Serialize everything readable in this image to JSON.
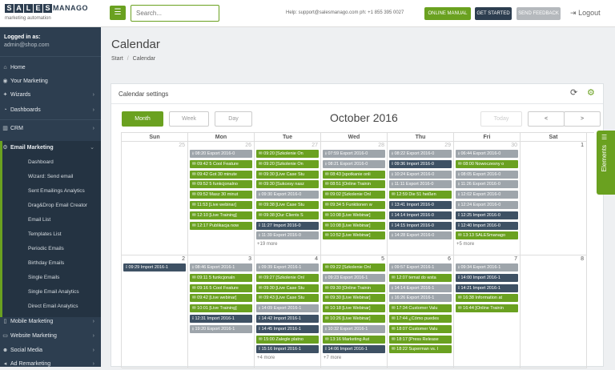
{
  "brand": {
    "logo_letters": [
      "S",
      "A",
      "L",
      "E",
      "S"
    ],
    "logo_word": "MANAGO",
    "tagline": "marketing automation",
    "accent": "#6aa120",
    "dark": "#2d3e50"
  },
  "top": {
    "search_placeholder": "Search...",
    "help": "Help:  support@salesmanago.com ph: +1 855 395 0027",
    "online_manual": "ONLINE MANUAL",
    "get_started": "GET STARTED",
    "send_feedback": "SEND FEEDBACK",
    "logout": "Logout"
  },
  "sidebar": {
    "logged_as": "Logged in as:",
    "email": "admin@shop.com",
    "items": [
      {
        "label": "Home",
        "icon": "home-icon"
      },
      {
        "label": "Your Marketing",
        "icon": "eye-icon"
      },
      {
        "label": "Wizards",
        "icon": "wand-icon"
      },
      {
        "label": "Dashboards",
        "icon": "dashboard-icon"
      },
      {
        "label": "CRM",
        "icon": "chart-icon"
      },
      {
        "label": "Email Marketing",
        "icon": "gear-icon"
      }
    ],
    "email_sub": [
      "Dashboard",
      "Wizard: Send email",
      "Sent Emailings Analytics",
      "Drag&Drop Email Creator",
      "Email List",
      "Templates List",
      "Periodic Emails",
      "Birthday Emails",
      "Single Emails",
      "Single Email Analytics",
      "Direct Email Analytics"
    ],
    "bottom": [
      {
        "label": "Mobile Marketing",
        "icon": "mobile-icon"
      },
      {
        "label": "Website Marketing",
        "icon": "monitor-icon"
      },
      {
        "label": "Social Media",
        "icon": "users-icon"
      },
      {
        "label": "Ad Remarketing",
        "icon": "megaphone-icon"
      }
    ]
  },
  "page": {
    "title": "Calendar",
    "crumb_start": "Start",
    "crumb_sep": "/",
    "crumb_current": "Calendar"
  },
  "calendar": {
    "settings_title": "Calendar settings",
    "views": {
      "month": "Month",
      "week": "Week",
      "day": "Day"
    },
    "title": "October 2016",
    "today": "Today",
    "prev": "<",
    "next": ">",
    "weekdays": [
      "Sun",
      "Mon",
      "Tue",
      "Wed",
      "Thu",
      "Fri",
      "Sat"
    ],
    "week1_days": [
      "25",
      "26",
      "27",
      "28",
      "29",
      "30",
      "1"
    ],
    "week2_days": [
      "2",
      "3",
      "4",
      "5",
      "6",
      "7",
      "8"
    ],
    "week1": [
      [],
      [
        {
          "t": "08:20 Export 2016-0",
          "c": "s",
          "i": "download-icon"
        },
        {
          "t": "09:42 5 Cool Feature",
          "c": "g",
          "i": "envelope-icon"
        },
        {
          "t": "09:42 Got 30 minute",
          "c": "g",
          "i": "envelope-icon"
        },
        {
          "t": "09:52 5 funkcjonalno",
          "c": "g",
          "i": "envelope-icon"
        },
        {
          "t": "09:52 Masz 30 minut",
          "c": "g",
          "i": "envelope-icon"
        },
        {
          "t": "11:53 [Live webinar]",
          "c": "g",
          "i": "envelope-icon"
        },
        {
          "t": "12:10 [Live Training]",
          "c": "g",
          "i": "envelope-icon"
        },
        {
          "t": "12:17 Publikacja now",
          "c": "g",
          "i": "envelope-icon"
        }
      ],
      [
        {
          "t": "09:20 [Szkolenie On",
          "c": "g",
          "i": "envelope-icon"
        },
        {
          "t": "09:20 [Szkolenie On",
          "c": "g",
          "i": "envelope-icon"
        },
        {
          "t": "09:30 [Live Case Stu",
          "c": "g",
          "i": "envelope-icon"
        },
        {
          "t": "09:30 [Sukcesy nasz",
          "c": "g",
          "i": "envelope-icon"
        },
        {
          "t": "09:30 Export 2016-0",
          "c": "s",
          "i": "download-icon"
        },
        {
          "t": "09:38 [Live Case Stu",
          "c": "g",
          "i": "envelope-icon"
        },
        {
          "t": "09:38 [Our Clients S",
          "c": "g",
          "i": "envelope-icon"
        },
        {
          "t": "11:27 Import 2016-0",
          "c": "n",
          "i": "upload-icon"
        },
        {
          "t": "11:39 Export 2016-0",
          "c": "s",
          "i": "download-icon"
        }
      ],
      [
        {
          "t": "07:59 Export 2016-0",
          "c": "s",
          "i": "download-icon"
        },
        {
          "t": "08:21 Export 2016-0",
          "c": "s",
          "i": "download-icon"
        },
        {
          "t": "08:43 [spotkanie onli",
          "c": "g",
          "i": "envelope-icon"
        },
        {
          "t": "08:51 [Online Trainin",
          "c": "g",
          "i": "envelope-icon"
        },
        {
          "t": "09:02 [Szkolenie Onl",
          "c": "g",
          "i": "envelope-icon"
        },
        {
          "t": "09:34 5 Funktionen w",
          "c": "g",
          "i": "envelope-icon"
        },
        {
          "t": "10:08 [Live Webinar]",
          "c": "g",
          "i": "envelope-icon"
        },
        {
          "t": "10:08 [Live Webinar]",
          "c": "g",
          "i": "envelope-icon"
        },
        {
          "t": "10:52 [Live Webinar]",
          "c": "g",
          "i": "envelope-icon"
        }
      ],
      [
        {
          "t": "08:22 Export 2016-0",
          "c": "s",
          "i": "download-icon"
        },
        {
          "t": "09:36 Import 2016-0",
          "c": "n",
          "i": "upload-icon"
        },
        {
          "t": "10:24 Export 2016-0",
          "c": "s",
          "i": "download-icon"
        },
        {
          "t": "11:11 Export 2016-0",
          "c": "s",
          "i": "download-icon"
        },
        {
          "t": "12:59 Die 51 heißen",
          "c": "g",
          "i": "envelope-icon"
        },
        {
          "t": "13:41 Import 2016-0",
          "c": "n",
          "i": "upload-icon"
        },
        {
          "t": "14:14 Import 2016-0",
          "c": "n",
          "i": "upload-icon"
        },
        {
          "t": "14:15 Import 2016-0",
          "c": "n",
          "i": "upload-icon"
        },
        {
          "t": "14:28 Export 2016-0",
          "c": "s",
          "i": "download-icon"
        }
      ],
      [
        {
          "t": "06:44 Export 2016-0",
          "c": "s",
          "i": "download-icon"
        },
        {
          "t": "08:00 Nowoczesny o",
          "c": "g",
          "i": "envelope-icon"
        },
        {
          "t": "08:05 Export 2016-0",
          "c": "s",
          "i": "download-icon"
        },
        {
          "t": "11:26 Export 2016-0",
          "c": "s",
          "i": "download-icon"
        },
        {
          "t": "12:02 Export 2016-0",
          "c": "s",
          "i": "download-icon"
        },
        {
          "t": "12:24 Export 2016-0",
          "c": "s",
          "i": "download-icon"
        },
        {
          "t": "12:25 Import 2016-0",
          "c": "n",
          "i": "upload-icon"
        },
        {
          "t": "12:40 Import 2016-0",
          "c": "n",
          "i": "upload-icon"
        },
        {
          "t": "13:13 SALESmanago",
          "c": "g",
          "i": "envelope-icon"
        }
      ],
      []
    ],
    "week1_more": [
      "",
      "",
      "+19 more",
      "",
      "",
      "+5 more",
      ""
    ],
    "week2": [
      [
        {
          "t": "09:29 Import 2016-1",
          "c": "n",
          "i": "upload-icon"
        }
      ],
      [
        {
          "t": "08:46 Export 2016-1",
          "c": "s",
          "i": "download-icon"
        },
        {
          "t": "09:11 5 funkcjonaln",
          "c": "g",
          "i": "envelope-icon"
        },
        {
          "t": "09:16 5 Cool Feature",
          "c": "g",
          "i": "envelope-icon"
        },
        {
          "t": "09:42 [Live webinar]",
          "c": "g",
          "i": "envelope-icon"
        },
        {
          "t": "10:01 [Live Training]",
          "c": "g",
          "i": "envelope-icon"
        },
        {
          "t": "12:31 Import 2016-1",
          "c": "n",
          "i": "upload-icon"
        },
        {
          "t": "19:20 Export 2016-1",
          "c": "s",
          "i": "download-icon"
        }
      ],
      [
        {
          "t": "09:39 Export 2016-1",
          "c": "s",
          "i": "download-icon"
        },
        {
          "t": "09:27 [Szkolenie Onl",
          "c": "g",
          "i": "envelope-icon"
        },
        {
          "t": "09:30 [Live Case Stu",
          "c": "g",
          "i": "envelope-icon"
        },
        {
          "t": "09:43 [Live Case Stu",
          "c": "g",
          "i": "envelope-icon"
        },
        {
          "t": "14:09 Export 2016-1",
          "c": "s",
          "i": "download-icon"
        },
        {
          "t": "14:42 Import 2016-1",
          "c": "n",
          "i": "upload-icon"
        },
        {
          "t": "14:45 Import 2016-1",
          "c": "n",
          "i": "upload-icon"
        },
        {
          "t": "15:00 Zalegle platno",
          "c": "g",
          "i": "envelope-icon"
        },
        {
          "t": "15:16 Import 2016-1",
          "c": "n",
          "i": "upload-icon"
        }
      ],
      [
        {
          "t": "09:22 [Szkolenie Onl",
          "c": "g",
          "i": "envelope-icon"
        },
        {
          "t": "09:23 Export 2016-1",
          "c": "s",
          "i": "download-icon"
        },
        {
          "t": "09:30 [Online Trainin",
          "c": "g",
          "i": "envelope-icon"
        },
        {
          "t": "09:30 [Live Webinar]",
          "c": "g",
          "i": "envelope-icon"
        },
        {
          "t": "10:18 [Live Webinar]",
          "c": "g",
          "i": "envelope-icon"
        },
        {
          "t": "10:26 [Live Webinar]",
          "c": "g",
          "i": "envelope-icon"
        },
        {
          "t": "10:32 Export 2016-1",
          "c": "s",
          "i": "download-icon"
        },
        {
          "t": "13:16 Marketing Aut",
          "c": "g",
          "i": "envelope-icon"
        },
        {
          "t": "14:06 Import 2016-1",
          "c": "n",
          "i": "upload-icon"
        }
      ],
      [
        {
          "t": "09:57 Export 2016-1",
          "c": "s",
          "i": "download-icon"
        },
        {
          "t": "12:07 temat do wsta",
          "c": "g",
          "i": "envelope-icon"
        },
        {
          "t": "14:14 Export 2016-1",
          "c": "s",
          "i": "download-icon"
        },
        {
          "t": "16:26 Export 2016-1",
          "c": "s",
          "i": "download-icon"
        },
        {
          "t": "17:34 Customer Valu",
          "c": "g",
          "i": "envelope-icon"
        },
        {
          "t": "17:44 ¿Cómo puedes",
          "c": "g",
          "i": "envelope-icon"
        },
        {
          "t": "18:07 Customer Valu",
          "c": "g",
          "i": "envelope-icon"
        },
        {
          "t": "18:17 [Press Release",
          "c": "g",
          "i": "envelope-icon"
        },
        {
          "t": "18:22 Superman vs. l",
          "c": "g",
          "i": "envelope-icon"
        }
      ],
      [
        {
          "t": "09:34 Export 2016-1",
          "c": "s",
          "i": "download-icon"
        },
        {
          "t": "14:00 Import 2016-1",
          "c": "n",
          "i": "upload-icon"
        },
        {
          "t": "14:21 Import 2016-1",
          "c": "n",
          "i": "upload-icon"
        },
        {
          "t": "16:38 Information at",
          "c": "g",
          "i": "envelope-icon"
        },
        {
          "t": "16:44 [Online Trainin",
          "c": "g",
          "i": "envelope-icon"
        }
      ],
      []
    ],
    "week2_more": [
      "",
      "",
      "+4 more",
      "+7 more",
      "",
      "",
      ""
    ]
  },
  "elements_tab": "Elements"
}
